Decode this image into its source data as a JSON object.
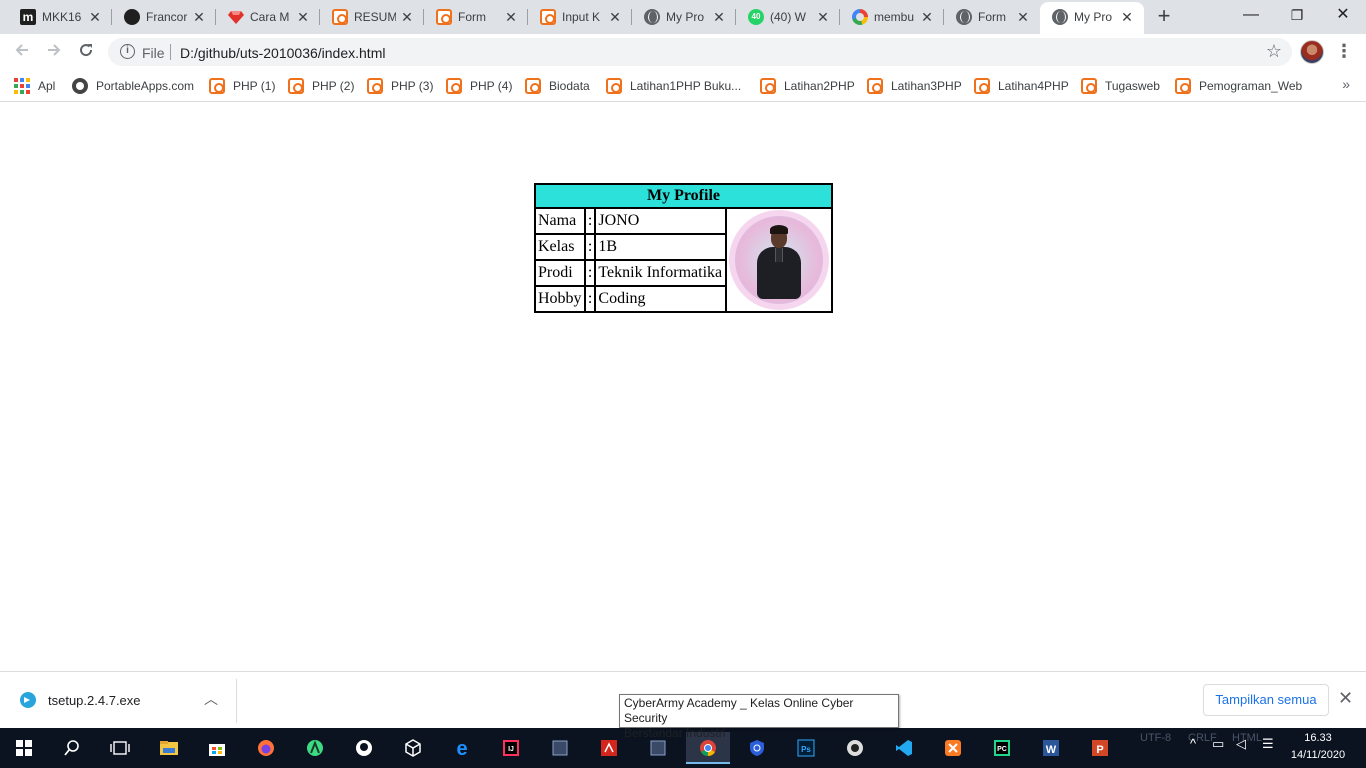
{
  "browser": {
    "tabs": [
      {
        "label": "MKK16",
        "icon": "m-icon",
        "active": false
      },
      {
        "label": "Francor",
        "icon": "github-icon",
        "active": false
      },
      {
        "label": "Cara M",
        "icon": "ruby-icon",
        "active": false
      },
      {
        "label": "RESUM",
        "icon": "xampp-icon",
        "active": false
      },
      {
        "label": "Form",
        "icon": "xampp-icon",
        "active": false
      },
      {
        "label": "Input K",
        "icon": "xampp-icon",
        "active": false
      },
      {
        "label": "My Pro",
        "icon": "globe-icon",
        "active": false
      },
      {
        "label": "(40) W",
        "icon": "whatsapp-icon",
        "active": false
      },
      {
        "label": "membu",
        "icon": "google-icon",
        "active": false
      },
      {
        "label": "Form",
        "icon": "globe-icon",
        "active": false
      },
      {
        "label": "My Pro",
        "icon": "globe-icon",
        "active": true
      }
    ],
    "new_tab": "+",
    "window_controls": {
      "minimize": "—",
      "maximize": "❐",
      "close": "✕"
    },
    "omnibox": {
      "scheme_label": "File",
      "url": "D:/github/uts-2010036/index.html"
    },
    "bookmarks": [
      {
        "label": "Apl",
        "icon": "apps-grid-icon"
      },
      {
        "label": "PortableApps.com",
        "icon": "portableapps-icon"
      },
      {
        "label": "PHP (1)",
        "icon": "xampp-icon"
      },
      {
        "label": "PHP (2)",
        "icon": "xampp-icon"
      },
      {
        "label": "PHP (3)",
        "icon": "xampp-icon"
      },
      {
        "label": "PHP (4)",
        "icon": "xampp-icon"
      },
      {
        "label": "Biodata",
        "icon": "xampp-icon"
      },
      {
        "label": "Latihan1PHP Buku...",
        "icon": "xampp-icon"
      },
      {
        "label": "Latihan2PHP",
        "icon": "xampp-icon"
      },
      {
        "label": "Latihan3PHP",
        "icon": "xampp-icon"
      },
      {
        "label": "Latihan4PHP",
        "icon": "xampp-icon"
      },
      {
        "label": "Tugasweb",
        "icon": "xampp-icon"
      },
      {
        "label": "Pemograman_Web",
        "icon": "xampp-icon"
      }
    ],
    "bookmarks_more": "»"
  },
  "page": {
    "profile_table": {
      "title": "My Profile",
      "separator": ":",
      "rows": [
        {
          "label": "Nama",
          "value": "JONO"
        },
        {
          "label": "Kelas",
          "value": "1B"
        },
        {
          "label": "Prodi",
          "value": "Teknik Informatika"
        },
        {
          "label": "Hobby",
          "value": "Coding"
        }
      ]
    }
  },
  "download_bar": {
    "file_name": "tsetup.2.4.7.exe",
    "show_all": "Tampilkan semua",
    "close": "✕"
  },
  "tooltip": {
    "line1": "CyberArmy Academy _ Kelas Online Cyber Security",
    "line2": "Berstandar Industri"
  },
  "taskbar": {
    "time": "16.33",
    "date": "14/11/2020",
    "faded_statusbar": [
      "UTF-8",
      "CRLF",
      "HTML"
    ]
  },
  "colors": {
    "table_header_bg": "#2de1db",
    "tab_strip": "#dee1e6",
    "xampp_orange": "#f0711c",
    "link_blue": "#1a73e8",
    "taskbar": "#0b1220"
  }
}
